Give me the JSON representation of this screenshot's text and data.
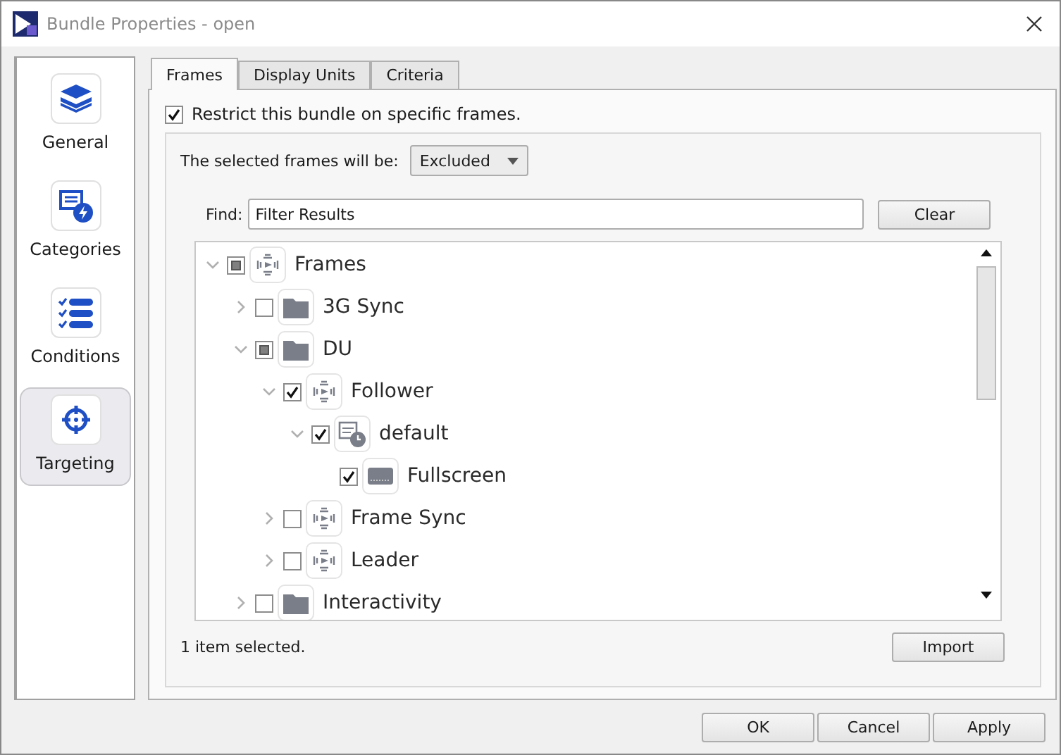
{
  "window": {
    "title": "Bundle Properties - open"
  },
  "sidebar": {
    "items": [
      {
        "label": "General",
        "kind": "layers",
        "selected": false
      },
      {
        "label": "Categories",
        "kind": "card-bolt",
        "selected": false
      },
      {
        "label": "Conditions",
        "kind": "checklist",
        "selected": false
      },
      {
        "label": "Targeting",
        "kind": "crosshair",
        "selected": true
      }
    ]
  },
  "tabs": [
    {
      "label": "Frames",
      "selected": true
    },
    {
      "label": "Display Units",
      "selected": false
    },
    {
      "label": "Criteria",
      "selected": false
    }
  ],
  "restrict": {
    "label": "Restrict this bundle on specific frames.",
    "checked": true
  },
  "mode": {
    "label": "The selected frames will be:",
    "value": "Excluded"
  },
  "find": {
    "label": "Find:",
    "value": "Filter Results"
  },
  "clear_button": "Clear",
  "tree": [
    {
      "label": "Frames",
      "kind": "frames",
      "checked": false,
      "indeterminate": true,
      "expanded": true,
      "children": [
        {
          "label": "3G Sync",
          "kind": "folder",
          "checked": false,
          "indeterminate": false,
          "expanded": false
        },
        {
          "label": "DU",
          "kind": "folder",
          "checked": false,
          "indeterminate": true,
          "expanded": true,
          "children": [
            {
              "label": "Follower",
              "kind": "frames",
              "checked": true,
              "indeterminate": false,
              "expanded": true,
              "children": [
                {
                  "label": "default",
                  "kind": "schedule",
                  "checked": true,
                  "indeterminate": false,
                  "expanded": true,
                  "children": [
                    {
                      "label": "Fullscreen",
                      "kind": "screen",
                      "checked": true,
                      "indeterminate": false
                    }
                  ]
                }
              ]
            },
            {
              "label": "Frame Sync",
              "kind": "frames",
              "checked": false,
              "indeterminate": false,
              "expanded": false
            },
            {
              "label": "Leader",
              "kind": "frames",
              "checked": false,
              "indeterminate": false,
              "expanded": false
            }
          ]
        },
        {
          "label": "Interactivity",
          "kind": "folder",
          "checked": false,
          "indeterminate": false,
          "expanded": false
        }
      ]
    }
  ],
  "status": "1 item selected.",
  "import_button": "Import",
  "buttons": [
    "OK",
    "Cancel",
    "Apply"
  ]
}
